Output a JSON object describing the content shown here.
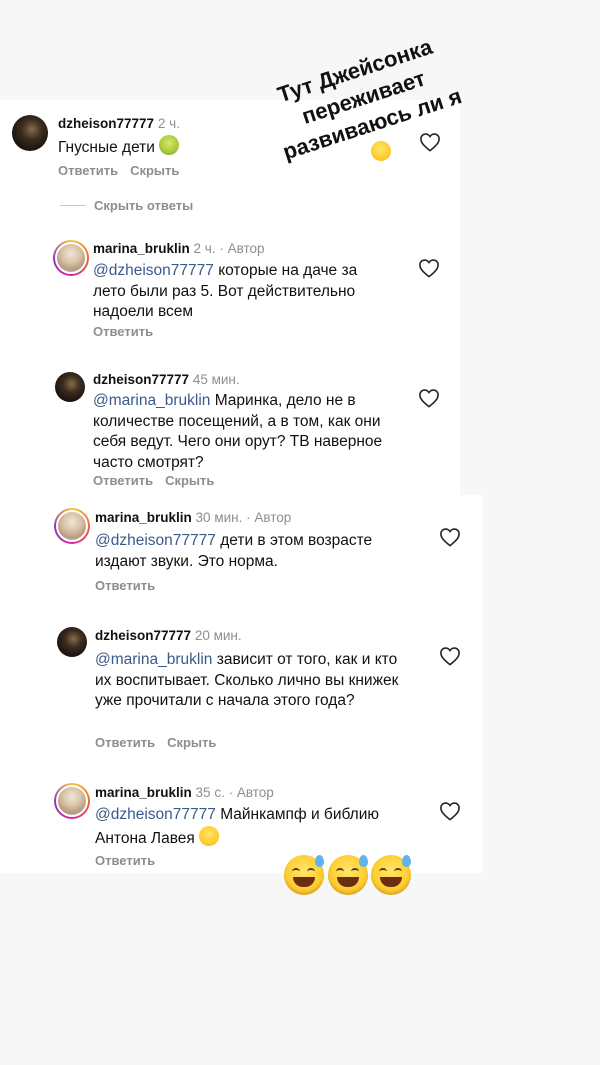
{
  "story_caption": {
    "lines": [
      "Тут Джейсонка",
      "переживает",
      "развиваюсь ли я"
    ],
    "emoji": "grinning-sweat-emoji"
  },
  "comments": [
    {
      "user": "dzheison77777",
      "time": "2 ч.",
      "author_tag": "",
      "mention": "",
      "text": "Гнусные дети",
      "emoji": "nauseated-face-emoji",
      "actions": [
        "Ответить",
        "Скрыть"
      ]
    },
    {
      "user": "marina_bruklin",
      "time": "2 ч.",
      "author_tag": "Автор",
      "mention": "@dzheison77777",
      "text": " которые на даче за лето были раз 5. Вот действительно надоели всем",
      "actions": [
        "Ответить"
      ]
    },
    {
      "user": "dzheison77777",
      "time": "45 мин.",
      "author_tag": "",
      "mention": "@marina_bruklin",
      "text": " Маринка, дело не в количестве посещений, а в том, как они себя ведут. Чего они орут? ТВ наверное часто смотрят?",
      "actions": [
        "Ответить",
        "Скрыть"
      ]
    },
    {
      "user": "marina_bruklin",
      "time": "30 мин.",
      "author_tag": "Автор",
      "mention": "@dzheison77777",
      "text": " дети в этом возрасте издают звуки. Это норма.",
      "actions": [
        "Ответить"
      ]
    },
    {
      "user": "dzheison77777",
      "time": "20 мин.",
      "author_tag": "",
      "mention": "@marina_bruklin",
      "text": " зависит от того, как и кто их воспитывает. Сколько лично вы книжек уже прочитали с начала этого года?",
      "actions": [
        "Ответить",
        "Скрыть"
      ]
    },
    {
      "user": "marina_bruklin",
      "time": "35 с.",
      "author_tag": "Автор",
      "mention": "@dzheison77777",
      "text": " Майнкампф и библию Антона Лавея",
      "emoji": "grinning-sweat-emoji",
      "actions": [
        "Ответить"
      ]
    }
  ],
  "hide_replies_label": "Скрыть ответы",
  "dot": "·",
  "sticker_emojis": [
    "grinning-sweat-emoji",
    "grinning-sweat-emoji",
    "grinning-sweat-emoji"
  ],
  "colors": {
    "mention": "#3a5a8a",
    "meta_gray": "#8e8e8e"
  }
}
